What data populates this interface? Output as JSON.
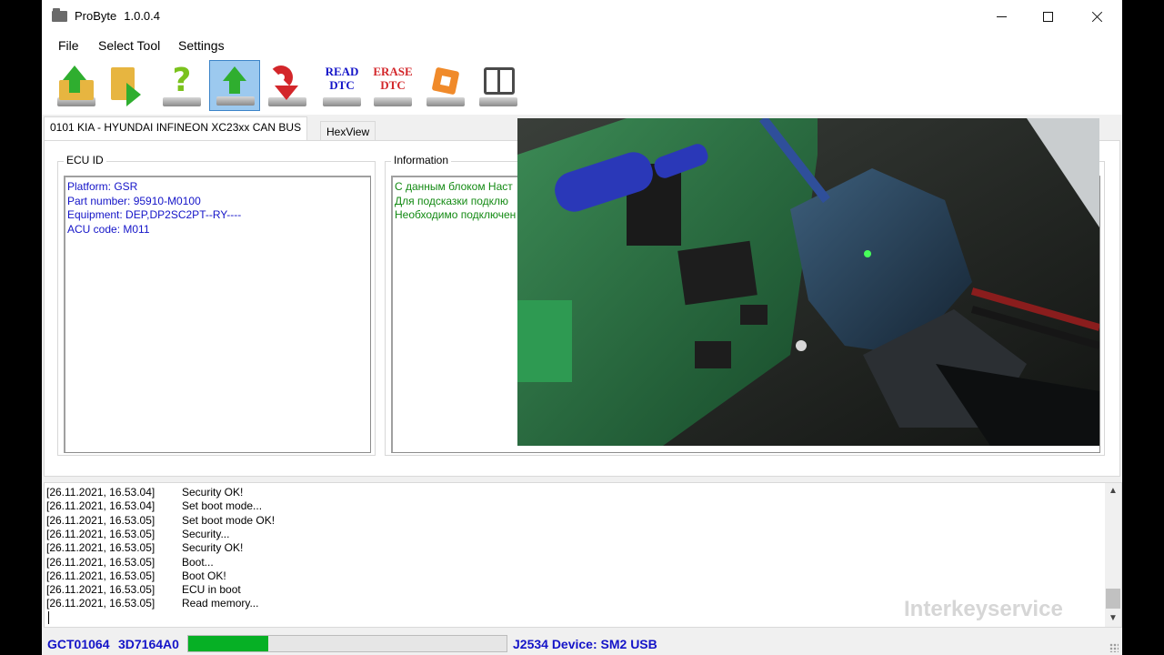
{
  "window": {
    "title": "ProByte",
    "version": "1.0.0.4"
  },
  "menu": [
    "File",
    "Select Tool",
    "Settings"
  ],
  "toolbar": {
    "read_dtc": [
      "READ",
      "DTC"
    ],
    "erase_dtc": [
      "ERASE",
      "DTC"
    ],
    "colors": {
      "read": "#1414c8",
      "erase": "#d3262a",
      "active_bg": "#9cc9ef"
    }
  },
  "tabs": [
    {
      "label": "0101 KIA - HYUNDAI INFINEON XC23xx CAN BUS",
      "active": true
    },
    {
      "label": "HexView",
      "active": false
    }
  ],
  "ecu_id": {
    "title": "ECU ID",
    "lines": [
      "Platform: GSR",
      "Part number: 95910-M0100",
      "Equipment: DEP,DP2SC2PT--RY----",
      "ACU code: M011"
    ]
  },
  "information": {
    "title": "Information",
    "lines": [
      "С данным блоком Наст",
      "Для подсказки подклю",
      "Необходимо подключен"
    ]
  },
  "log": [
    {
      "ts": "[26.11.2021, 16.53.04]",
      "msg": "Security OK!"
    },
    {
      "ts": "[26.11.2021, 16.53.04]",
      "msg": "Set boot mode..."
    },
    {
      "ts": "[26.11.2021, 16.53.05]",
      "msg": "Set boot mode OK!"
    },
    {
      "ts": "[26.11.2021, 16.53.05]",
      "msg": "Security..."
    },
    {
      "ts": "[26.11.2021, 16.53.05]",
      "msg": "Security OK!"
    },
    {
      "ts": "[26.11.2021, 16.53.05]",
      "msg": "Boot..."
    },
    {
      "ts": "[26.11.2021, 16.53.05]",
      "msg": "Boot OK!"
    },
    {
      "ts": "[26.11.2021, 16.53.05]",
      "msg": "ECU in boot"
    },
    {
      "ts": "[26.11.2021, 16.53.05]",
      "msg": "Read memory..."
    }
  ],
  "watermark": "Interkeyservice",
  "status": {
    "id1": "GCT01064",
    "id2": "3D7164A0",
    "progress_percent": 25,
    "device": "J2534 Device: SM2 USB"
  }
}
